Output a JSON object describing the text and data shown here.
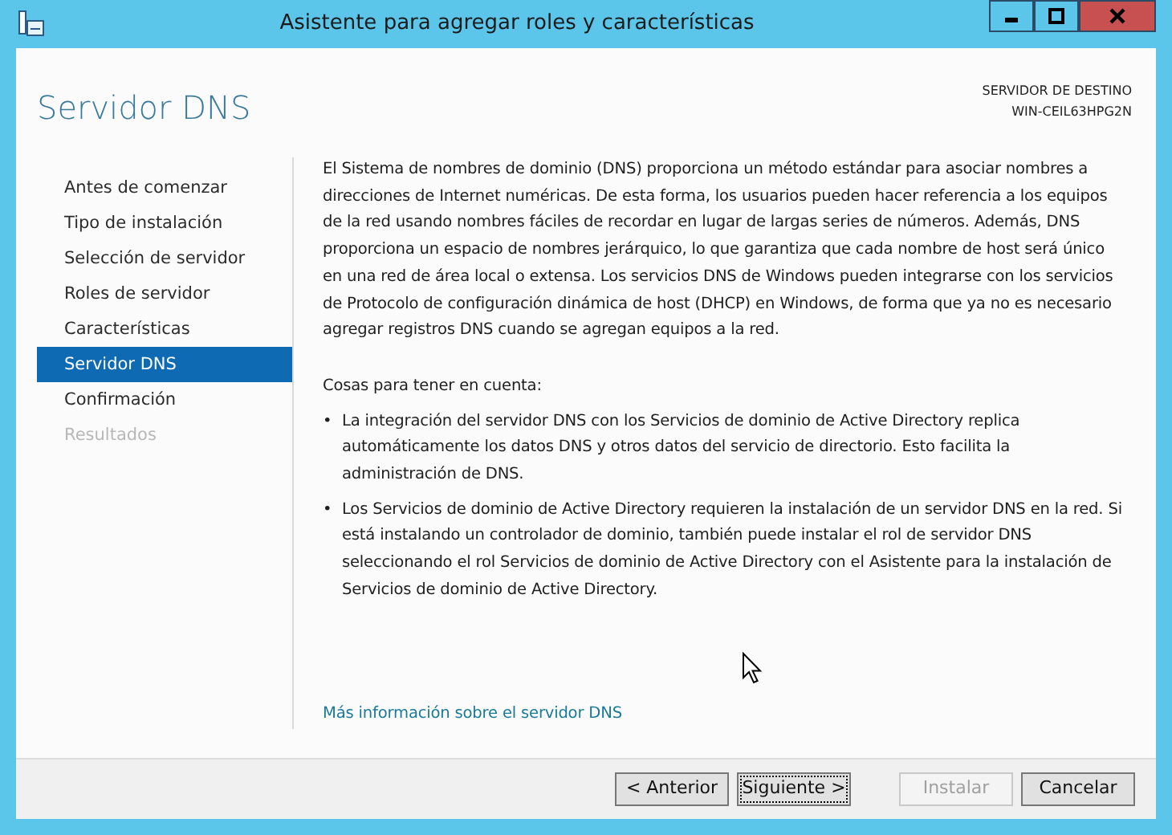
{
  "window": {
    "title": "Asistente para agregar roles y características"
  },
  "page_title": "Servidor DNS",
  "destination": {
    "label": "SERVIDOR DE DESTINO",
    "server": "WIN-CEIL63HPG2N"
  },
  "steps": [
    {
      "label": "Antes de comenzar",
      "selected": false,
      "disabled": false
    },
    {
      "label": "Tipo de instalación",
      "selected": false,
      "disabled": false
    },
    {
      "label": "Selección de servidor",
      "selected": false,
      "disabled": false
    },
    {
      "label": "Roles de servidor",
      "selected": false,
      "disabled": false
    },
    {
      "label": "Características",
      "selected": false,
      "disabled": false
    },
    {
      "label": "Servidor DNS",
      "selected": true,
      "disabled": false
    },
    {
      "label": "Confirmación",
      "selected": false,
      "disabled": false
    },
    {
      "label": "Resultados",
      "selected": false,
      "disabled": true
    }
  ],
  "description": "El Sistema de nombres de dominio (DNS) proporciona un método estándar para asociar nombres a direcciones de Internet numéricas. De esta forma, los usuarios pueden hacer referencia a los equipos de la red usando nombres fáciles de recordar en lugar de largas series de números. Además, DNS proporciona un espacio de nombres jerárquico, lo que garantiza que cada nombre de host será único en una red de área local o extensa. Los servicios DNS de Windows pueden integrarse con los servicios de Protocolo de configuración dinámica de host (DHCP) en Windows, de forma que ya no es necesario agregar registros DNS cuando se agregan equipos a la red.",
  "notes_heading": "Cosas para tener en cuenta:",
  "notes": [
    {
      "bullet": "•",
      "text": "La integración del servidor DNS con los Servicios de dominio de Active Directory replica automáticamente los datos DNS y otros datos del servicio de directorio. Esto facilita la administración de DNS."
    },
    {
      "bullet": "•",
      "text": "Los Servicios de dominio de Active Directory requieren la instalación de un servidor DNS en la red. Si está instalando un controlador de dominio, también puede instalar el rol de servidor DNS seleccionando el rol Servicios de dominio de Active Directory con el Asistente para la instalación de Servicios de dominio de Active Directory."
    }
  ],
  "more_info_link": "Más información sobre el servidor DNS",
  "buttons": [
    {
      "label": "< Anterior",
      "disabled": false,
      "focused": false
    },
    {
      "label": "Siguiente >",
      "disabled": false,
      "focused": true
    },
    {
      "label": "Instalar",
      "disabled": true,
      "focused": false
    },
    {
      "label": "Cancelar",
      "disabled": false,
      "focused": false
    }
  ]
}
